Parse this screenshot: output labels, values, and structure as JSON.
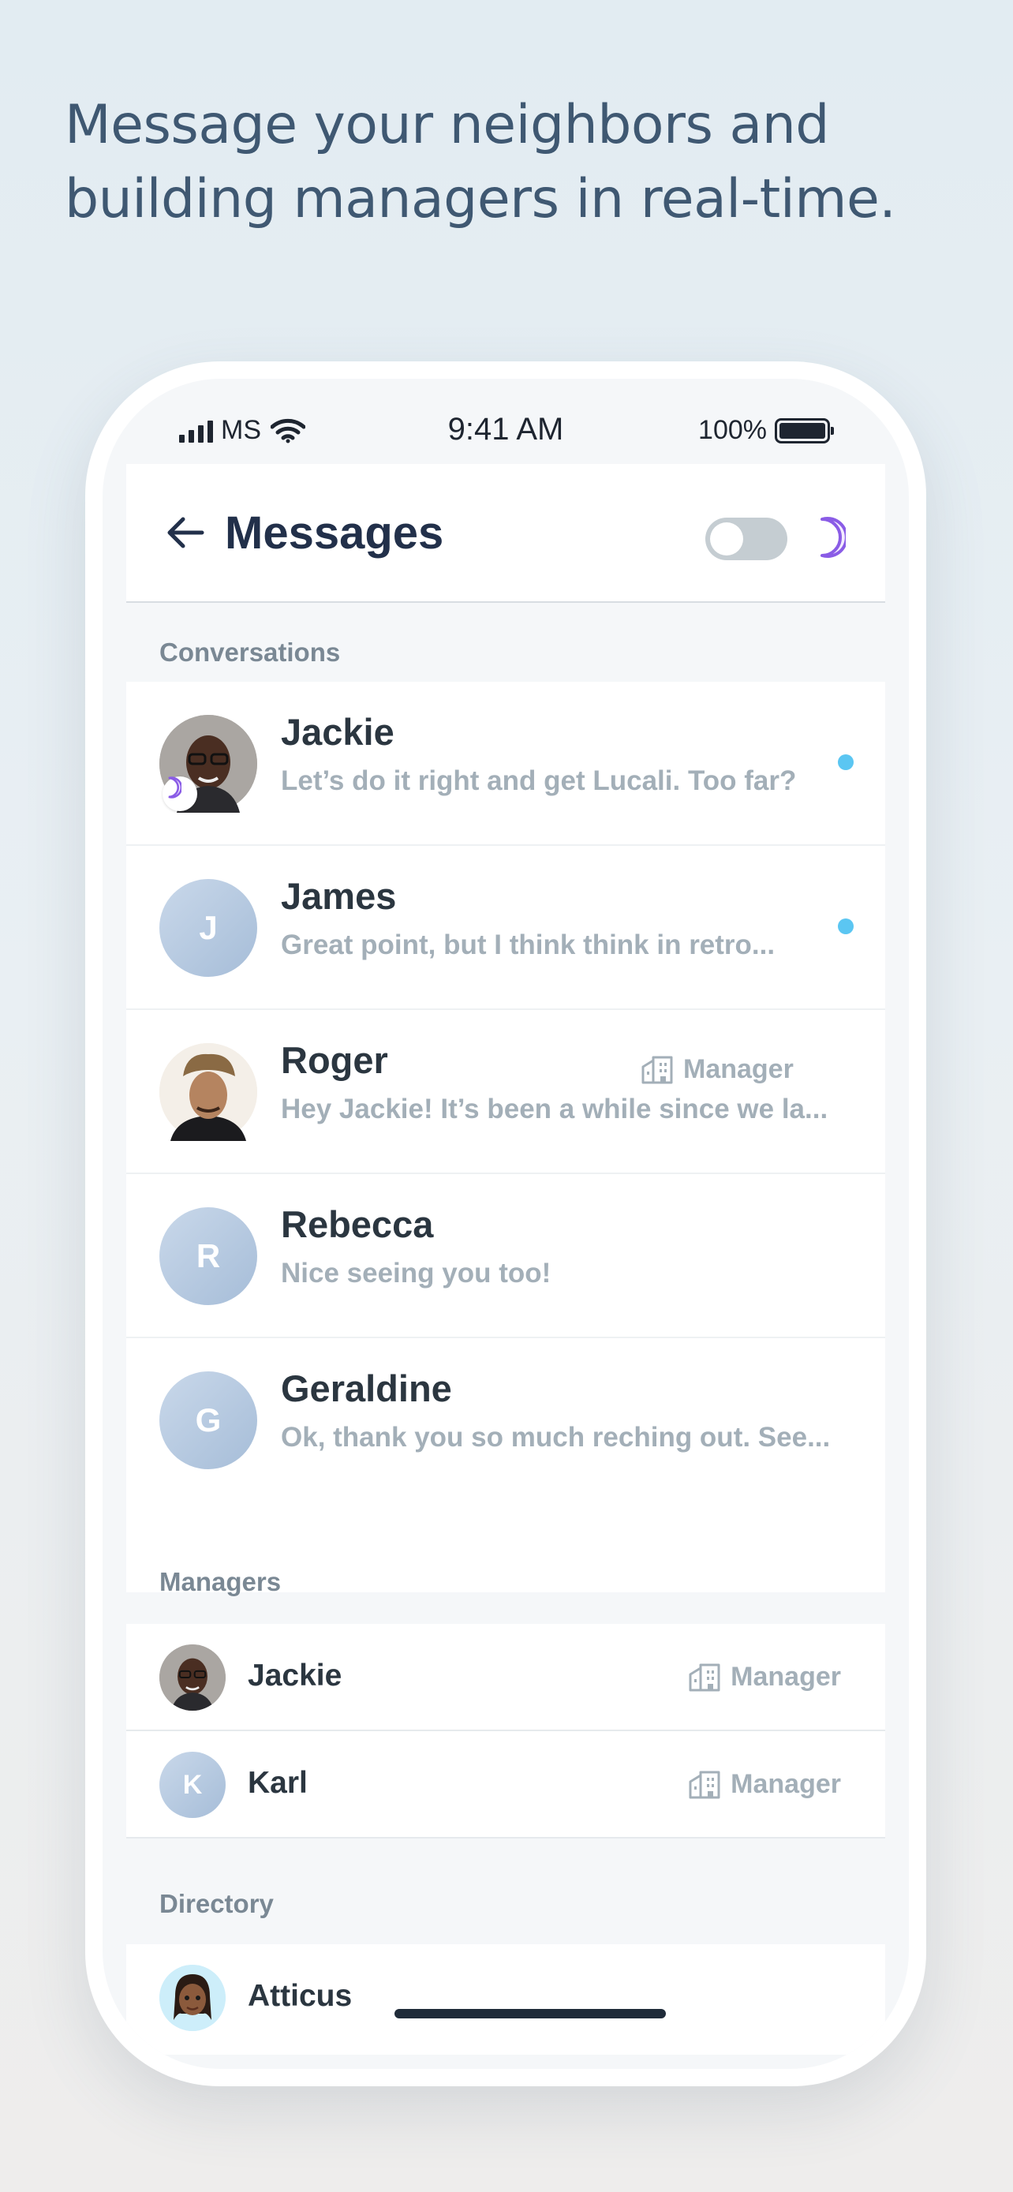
{
  "headline": "Message your neighbors and building managers in real-time.",
  "status_bar": {
    "carrier": "MS",
    "time": "9:41 AM",
    "battery": "100%"
  },
  "header": {
    "title": "Messages",
    "dark_mode_toggle": "off"
  },
  "conversations": {
    "label": "Conversations",
    "items": [
      {
        "name": "Jackie",
        "preview": "Let’s do it right and get Lucali. Too far?",
        "avatar": "photo",
        "unread": true
      },
      {
        "name": "James",
        "preview": "Great point, but I think think in retro...",
        "avatar_initial": "J",
        "unread": true
      },
      {
        "name": "Roger",
        "preview": "Hey Jackie! It’s been a while since we la...",
        "avatar": "photo",
        "role": "Manager"
      },
      {
        "name": "Rebecca",
        "preview": "Nice seeing you too!",
        "avatar_initial": "R"
      },
      {
        "name": "Geraldine",
        "preview": "Ok, thank you so much reching out. See...",
        "avatar_initial": "G"
      }
    ]
  },
  "managers": {
    "label": "Managers",
    "items": [
      {
        "name": "Jackie",
        "role": "Manager",
        "avatar": "photo"
      },
      {
        "name": "Karl",
        "role": "Manager",
        "avatar_initial": "K"
      }
    ]
  },
  "directory": {
    "label": "Directory",
    "items": [
      {
        "name": "Atticus",
        "avatar": "memoji"
      }
    ]
  },
  "colors": {
    "accent_purple": "#8a5ce6",
    "unread_dot": "#5bc6f2",
    "title": "#22304a",
    "headline": "#3f5872"
  }
}
